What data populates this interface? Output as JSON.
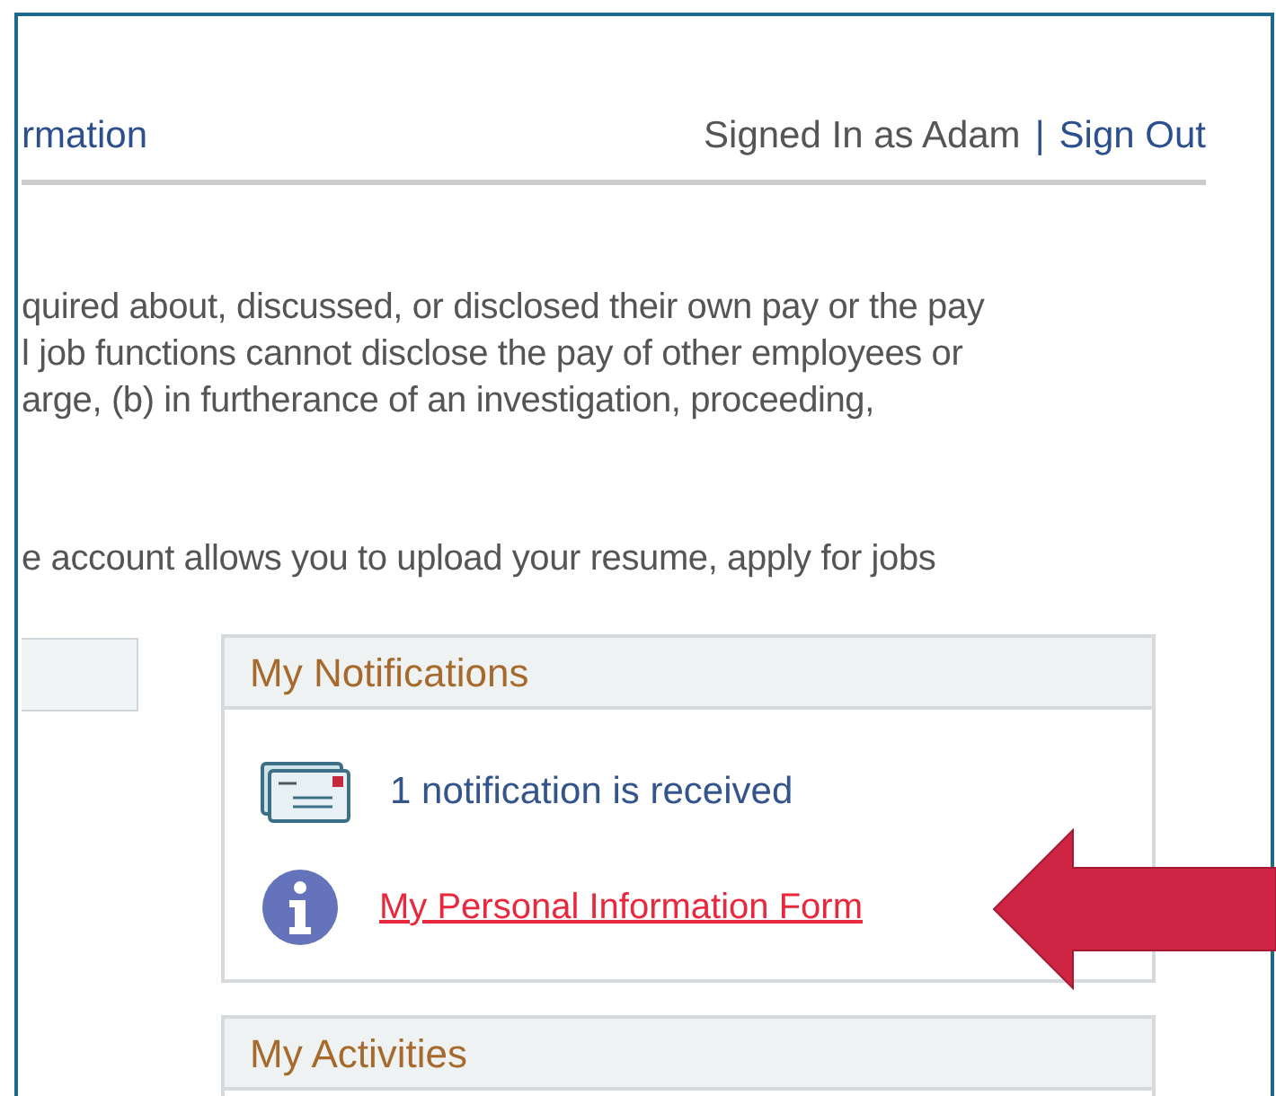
{
  "header": {
    "section_link": "rmation",
    "signed_in_text": "Signed In as Adam",
    "separator": "|",
    "sign_out_link": "Sign Out"
  },
  "notice_lines": [
    "quired about, discussed, or disclosed their own pay or the pay",
    "l job functions cannot disclose the pay of other employees or",
    "arge, (b) in furtherance of an investigation, proceeding,"
  ],
  "intro_line": "e account allows you to upload your resume, apply for jobs",
  "notifications": {
    "title": "My Notifications",
    "items": [
      {
        "kind": "message",
        "text": "1 notification is received"
      },
      {
        "kind": "link",
        "text": "My Personal Information Form"
      }
    ]
  },
  "activities": {
    "title": "My Activities"
  }
}
